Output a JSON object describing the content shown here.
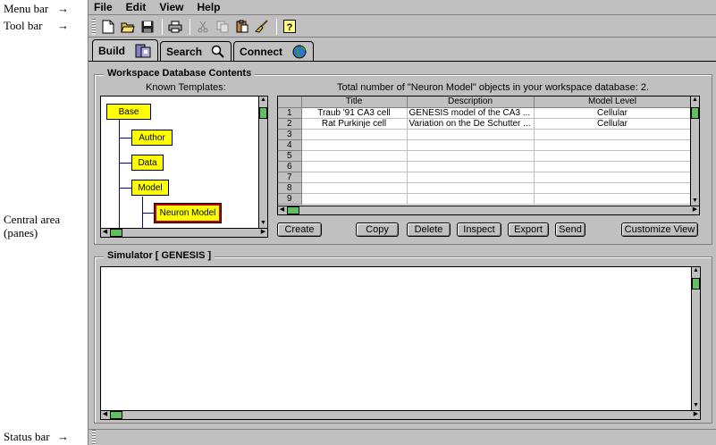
{
  "annotations": {
    "menu_bar": "Menu bar",
    "tool_bar": "Tool bar",
    "central_area_line1": "Central area",
    "central_area_line2": "(panes)",
    "status_bar": "Status bar",
    "arrow": "→"
  },
  "menu": [
    "File",
    "Edit",
    "View",
    "Help"
  ],
  "toolbar_icons": [
    "new-document-icon",
    "open-folder-icon",
    "save-disk-icon",
    "print-icon",
    "cut-icon",
    "copy-icon",
    "paste-icon",
    "broom-icon",
    "help-icon"
  ],
  "tabs": [
    {
      "label": "Build",
      "icon": "build-icon"
    },
    {
      "label": "Search",
      "icon": "magnifier-icon"
    },
    {
      "label": "Connect",
      "icon": "globe-icon"
    }
  ],
  "workspace": {
    "title": "Workspace Database Contents",
    "templates_label": "Known Templates:",
    "total_text": "Total number of \"Neuron Model\" objects in your workspace database: 2.",
    "tree": [
      "Base",
      "Author",
      "Data",
      "Model",
      "Neuron Model"
    ],
    "table": {
      "headers": [
        "Title",
        "Description",
        "Model Level"
      ],
      "rows": [
        [
          "1",
          "Traub '91 CA3 cell",
          "GENESIS model of the CA3 ...",
          "Cellular"
        ],
        [
          "2",
          "Rat Purkinje cell",
          "Variation on the De Schutter ...",
          "Cellular"
        ],
        [
          "3",
          "",
          "",
          ""
        ],
        [
          "4",
          "",
          "",
          ""
        ],
        [
          "5",
          "",
          "",
          ""
        ],
        [
          "6",
          "",
          "",
          ""
        ],
        [
          "7",
          "",
          "",
          ""
        ],
        [
          "8",
          "",
          "",
          ""
        ],
        [
          "9",
          "",
          "",
          ""
        ]
      ]
    },
    "buttons": {
      "create": "Create",
      "copy": "Copy",
      "delete": "Delete",
      "inspect": "Inspect",
      "export": "Export",
      "send": "Send",
      "customize": "Customize View"
    }
  },
  "simulator": {
    "title": "Simulator [ GENESIS ]"
  },
  "colors": {
    "window_bg": "#c0c0c0",
    "tree_node": "#ffff00",
    "selected_border": "#c00000",
    "tree_lines": "#0000c0",
    "scroll_thumb": "#60c060"
  }
}
